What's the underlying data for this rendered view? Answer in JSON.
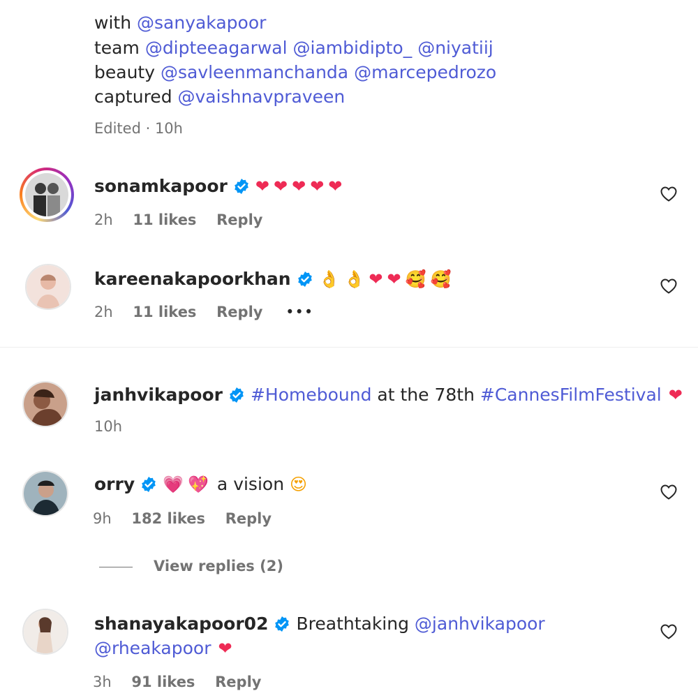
{
  "caption": {
    "line1": {
      "prefix": "with ",
      "mentions": [
        "@sanyakapoor"
      ]
    },
    "line2": {
      "prefix": "team ",
      "mentions": [
        "@dipteeagarwal",
        "@iambidipto_",
        "@niyatiij"
      ]
    },
    "line3": {
      "prefix": "beauty ",
      "mentions": [
        "@savleenmanchanda",
        "@marcepedrozo"
      ]
    },
    "line4": {
      "prefix": "captured ",
      "mentions": [
        "@vaishnavpraveen"
      ]
    },
    "edited": "Edited · 10h"
  },
  "comments": [
    {
      "username": "sonamkapoor",
      "emojis": [
        "❤",
        "❤",
        "❤",
        "❤",
        "❤"
      ],
      "time": "2h",
      "likes": "11 likes",
      "reply": "Reply"
    },
    {
      "username": "kareenakapoorkhan",
      "emojis": [
        "👌",
        "👌",
        "❤",
        "❤",
        "🥰",
        "🥰"
      ],
      "time": "2h",
      "likes": "11 likes",
      "reply": "Reply",
      "more": "•••"
    }
  ],
  "post": {
    "username": "janhvikapoor",
    "hashtag1": "#Homebound",
    "text_mid": " at the 78th ",
    "hashtag2": "#CannesFilmFestival",
    "emoji": "❤",
    "time": "10h"
  },
  "comments2": [
    {
      "username": "orry",
      "emoji1": "💗",
      "emoji2": "💖",
      "text": "a vision",
      "emoji3": "😍",
      "time": "9h",
      "likes": "182 likes",
      "reply": "Reply",
      "view_replies": "View replies (2)"
    },
    {
      "username": "shanayakapoor02",
      "text": "Breathtaking ",
      "mention1": "@janhvikapoor",
      "mention2": "@rheakapoor",
      "emoji": "❤",
      "time": "3h",
      "likes": "91 likes",
      "reply": "Reply"
    }
  ],
  "colors": {
    "mention": "#4f5bd5",
    "verified": "#0095f6",
    "heart": "#ee2b55",
    "meta": "#737373"
  }
}
